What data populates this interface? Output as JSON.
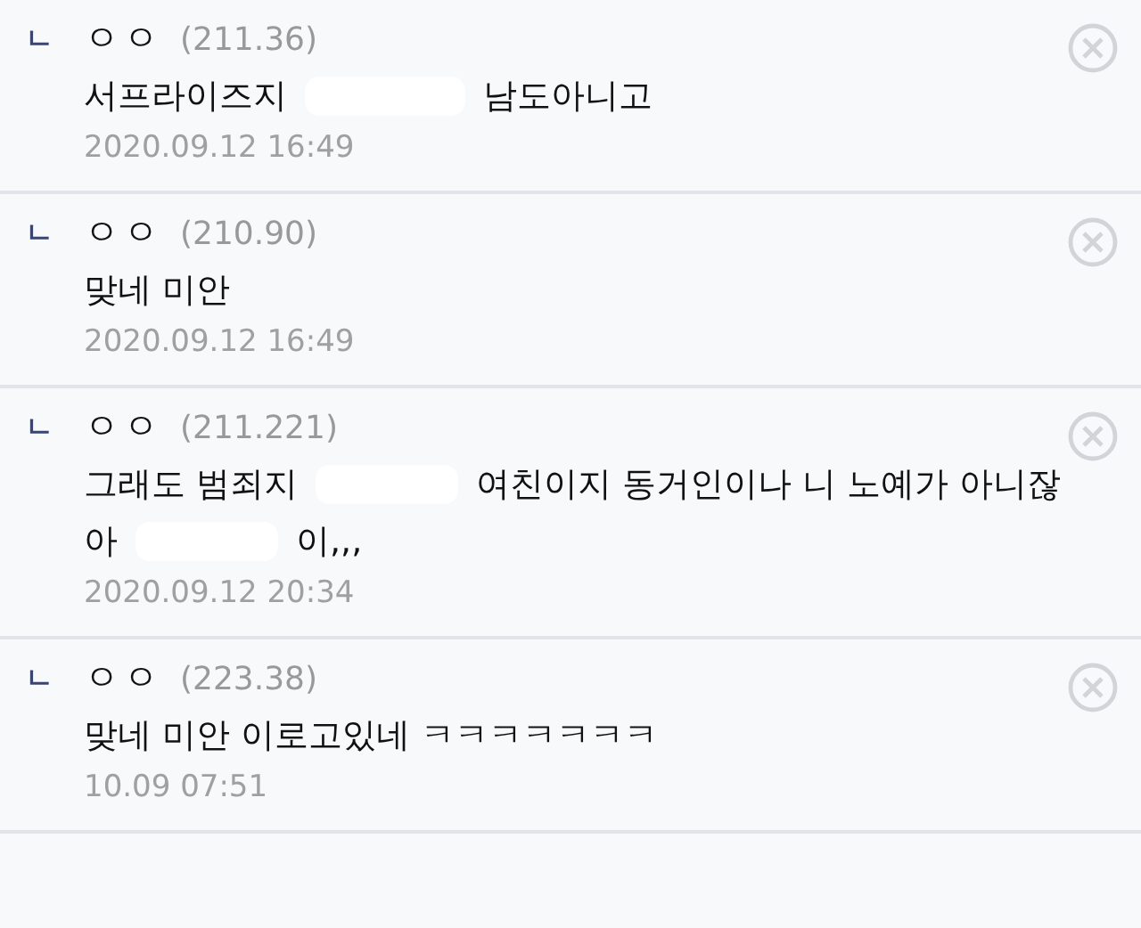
{
  "comments": [
    {
      "reply_mark": "ㄴ",
      "author": "ㅇㅇ",
      "ip": "(211.36)",
      "lines": [
        [
          {
            "kind": "text",
            "text": "서프라이즈지"
          },
          {
            "kind": "redaction"
          },
          {
            "kind": "text",
            "text": "남도아니고"
          }
        ]
      ],
      "date": "2020.09.12 16:49"
    },
    {
      "reply_mark": "ㄴ",
      "author": "ㅇㅇ",
      "ip": "(210.90)",
      "lines": [
        [
          {
            "kind": "text",
            "text": "맞네 미안"
          }
        ]
      ],
      "date": "2020.09.12 16:49"
    },
    {
      "reply_mark": "ㄴ",
      "author": "ㅇㅇ",
      "ip": "(211.221)",
      "lines": [
        [
          {
            "kind": "text",
            "text": "그래도 범죄지"
          },
          {
            "kind": "redaction"
          },
          {
            "kind": "text",
            "text": "여친이지 동거인이나 니 노예가 아니잖"
          }
        ],
        [
          {
            "kind": "text",
            "text": "아"
          },
          {
            "kind": "redaction"
          },
          {
            "kind": "text",
            "text": "이,,,"
          }
        ]
      ],
      "date": "2020.09.12 20:34"
    },
    {
      "reply_mark": "ㄴ",
      "author": "ㅇㅇ",
      "ip": "(223.38)",
      "lines": [
        [
          {
            "kind": "text",
            "text": "맞네 미안 이로고있네 ㅋㅋㅋㅋㅋㅋㅋ"
          }
        ]
      ],
      "date": "10.09 07:51"
    }
  ]
}
